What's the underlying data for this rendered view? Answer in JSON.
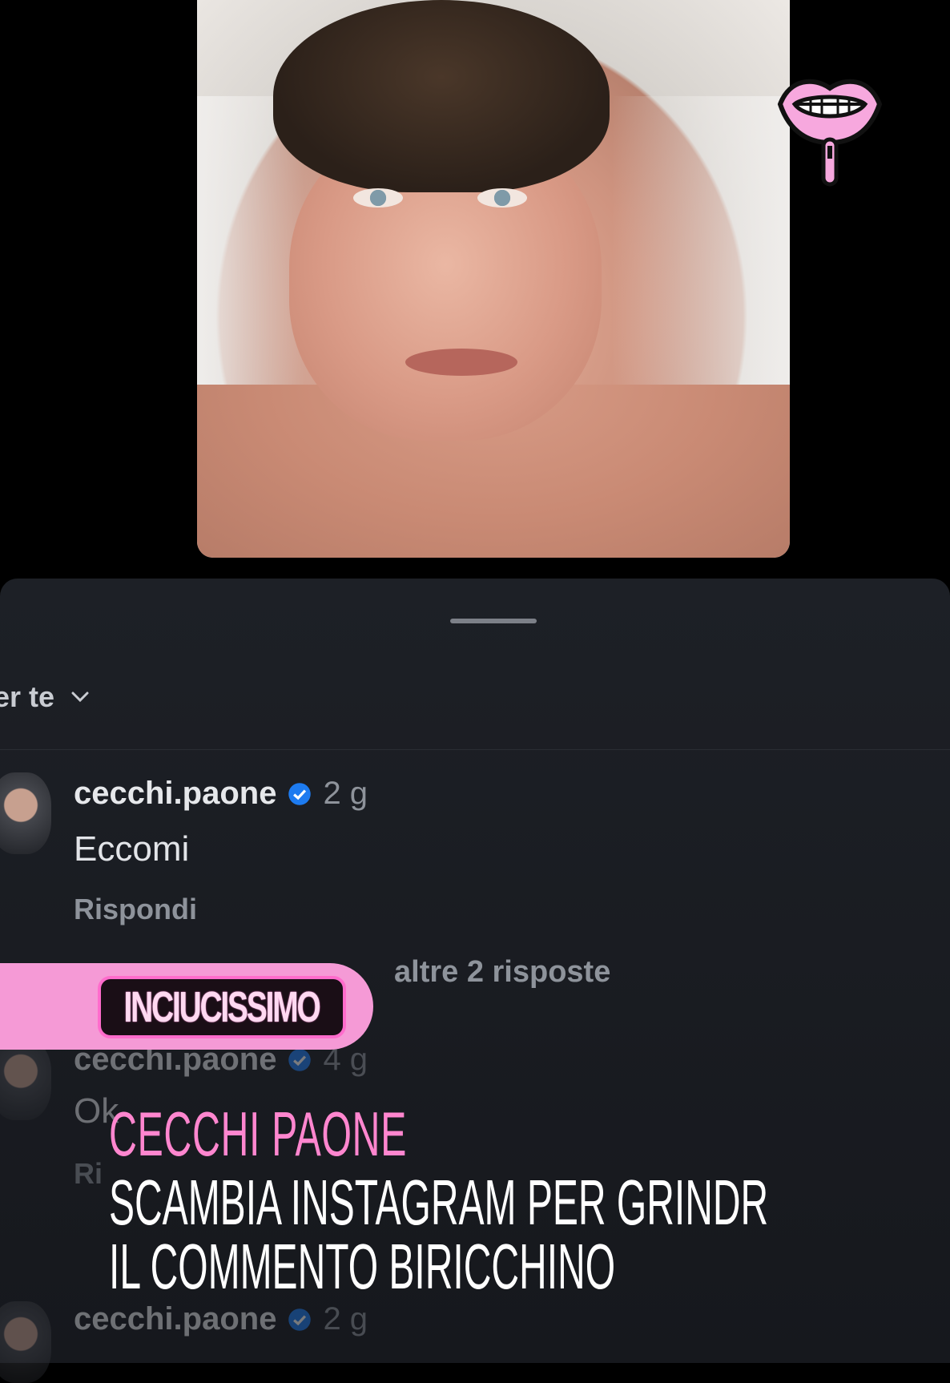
{
  "filter": {
    "label": "er te"
  },
  "comments": [
    {
      "username": "cecchi.paone",
      "time": "2 g",
      "text": "Eccomi",
      "reply": "Rispondi",
      "more_replies": "altre 2 risposte"
    },
    {
      "username": "cecchi.paone",
      "time": "4 g",
      "text": "Ok",
      "reply": "Ri"
    },
    {
      "username": "cecchi.paone",
      "time": "2 g"
    }
  ],
  "overlay": {
    "badge": "INCIUCISSIMO",
    "headline_1": "CECCHI PAONE",
    "headline_2": "SCAMBIA INSTAGRAM PER GRINDR",
    "headline_3": "IL COMMENTO BIRICCHINO"
  },
  "colors": {
    "accent_pink": "#f59ad6",
    "verified_blue": "#1d7bf0",
    "sheet_bg": "#1a1c21"
  },
  "icons": {
    "logo": "zipper-lips-logo",
    "verified": "verified-badge-icon",
    "chevron": "chevron-down-icon"
  }
}
